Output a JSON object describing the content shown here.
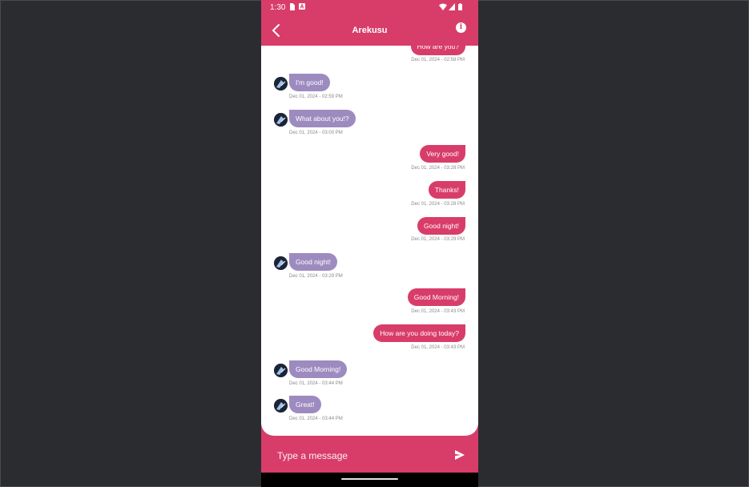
{
  "status_bar": {
    "time": "1:30"
  },
  "header": {
    "title": "Arekusu",
    "info_icon_glyph": "i"
  },
  "messages": [
    {
      "dir": "out",
      "text": "How are you?",
      "time": "Dec 01, 2024 - 02:58 PM"
    },
    {
      "dir": "in",
      "text": "I'm good!",
      "time": "Dec 01, 2024 - 02:59 PM"
    },
    {
      "dir": "in",
      "text": "What about you!?",
      "time": "Dec 01, 2024 - 03:00 PM"
    },
    {
      "dir": "out",
      "text": "Very good!",
      "time": "Dec 01, 2024 - 03:28 PM"
    },
    {
      "dir": "out",
      "text": "Thanks!",
      "time": "Dec 01, 2024 - 03:28 PM"
    },
    {
      "dir": "out",
      "text": "Good night!",
      "time": "Dec 01, 2024 - 03:29 PM"
    },
    {
      "dir": "in",
      "text": "Good night!",
      "time": "Dec 01, 2024 - 03:29 PM"
    },
    {
      "dir": "out",
      "text": "Good Morning!",
      "time": "Dec 01, 2024 - 03:43 PM"
    },
    {
      "dir": "out",
      "text": "How are you doing today?",
      "time": "Dec 01, 2024 - 03:43 PM"
    },
    {
      "dir": "in",
      "text": "Good Morning!",
      "time": "Dec 01, 2024 - 03:44 PM"
    },
    {
      "dir": "in",
      "text": "Great!",
      "time": "Dec 01, 2024 - 03:44 PM"
    }
  ],
  "composer": {
    "placeholder": "Type a message"
  },
  "colors": {
    "accent": "#d83d69",
    "incoming_bubble": "#9d8bc0",
    "background": "#2b2c30"
  }
}
